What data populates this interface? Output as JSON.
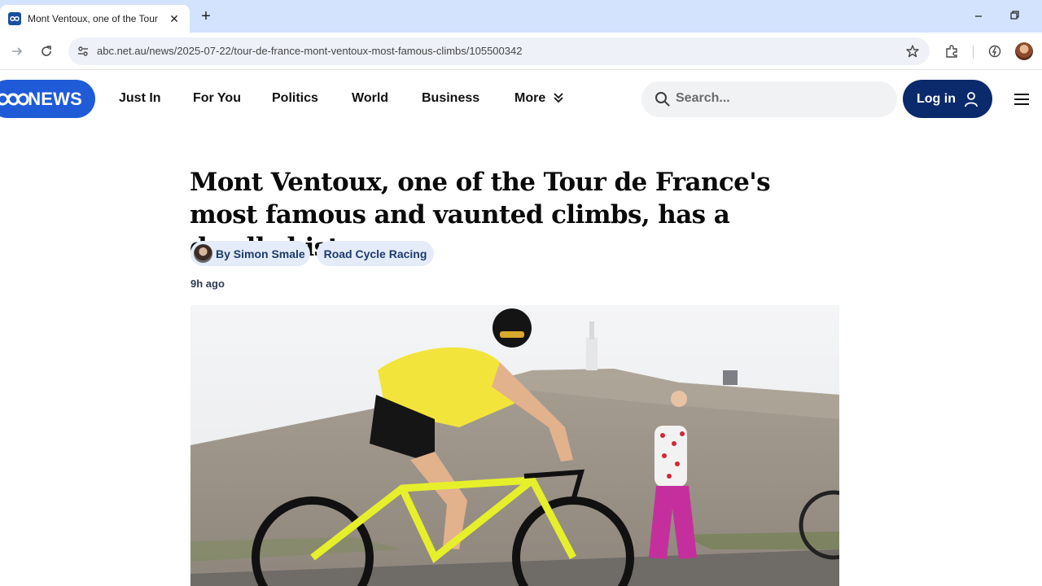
{
  "browser": {
    "tab_title": "Mont Ventoux, one of the Tour",
    "url": "abc.net.au/news/2025-07-22/tour-de-france-mont-ventoux-most-famous-climbs/105500342"
  },
  "header": {
    "logo_text": "NEWS",
    "nav": [
      "Just In",
      "For You",
      "Politics",
      "World",
      "Business",
      "More"
    ],
    "search_placeholder": "Search...",
    "login_label": "Log in"
  },
  "article": {
    "headline": "Mont Ventoux, one of the Tour de France's most famous and vaunted climbs, has a deadly history",
    "author": "By Simon Smale",
    "topic": "Road Cycle Racing",
    "timestamp": "9h ago"
  },
  "colors": {
    "abc_blue": "#1f5bd6",
    "login_navy": "#0b2a6b",
    "chip_bg": "#e4ecf9",
    "tabstrip": "#d3e3fd"
  }
}
